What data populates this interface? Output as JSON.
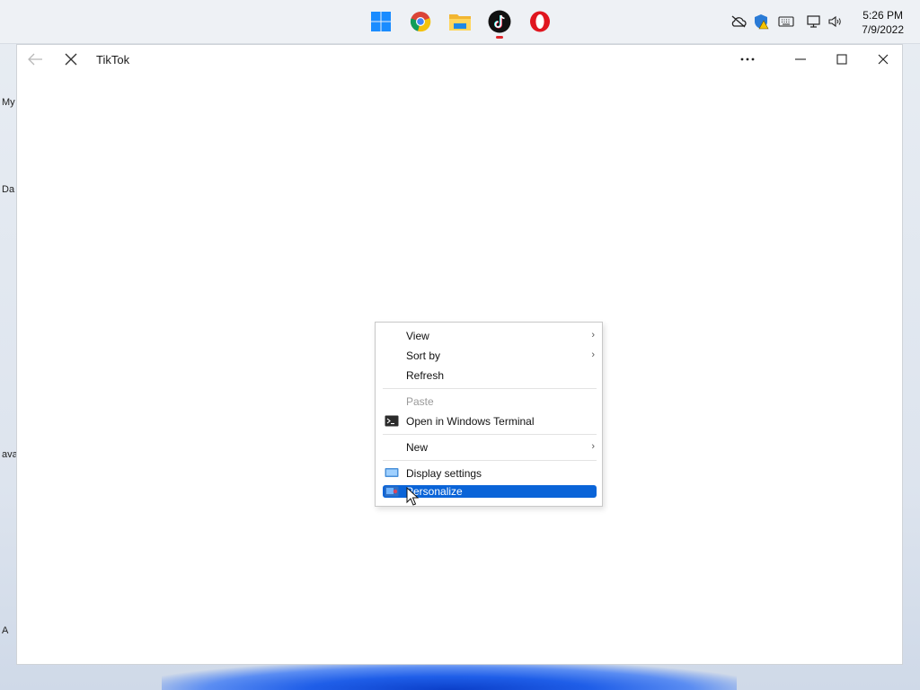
{
  "taskbar": {
    "apps": [
      "start-icon",
      "chrome-icon",
      "file-explorer-icon",
      "tiktok-icon",
      "opera-icon"
    ],
    "clock": {
      "time": "5:26 PM",
      "date": "7/9/2022"
    }
  },
  "desktop": {
    "icon_labels": [
      "My",
      "Da",
      "ava",
      "A"
    ]
  },
  "window": {
    "title": "TikTok"
  },
  "context_menu": {
    "items": [
      {
        "label": "View",
        "submenu": true
      },
      {
        "label": "Sort by",
        "submenu": true
      },
      {
        "label": "Refresh"
      },
      {
        "label": "Paste",
        "disabled": true
      },
      {
        "label": "Open in Windows Terminal",
        "icon": "terminal-icon"
      },
      {
        "label": "New",
        "submenu": true
      },
      {
        "label": "Display settings",
        "icon": "display-icon"
      },
      {
        "label": "Personalize",
        "icon": "personalize-icon",
        "highlighted": true
      }
    ]
  },
  "colors": {
    "highlight": "#0a64d8",
    "tiktok_indicator": "#e0262b"
  }
}
